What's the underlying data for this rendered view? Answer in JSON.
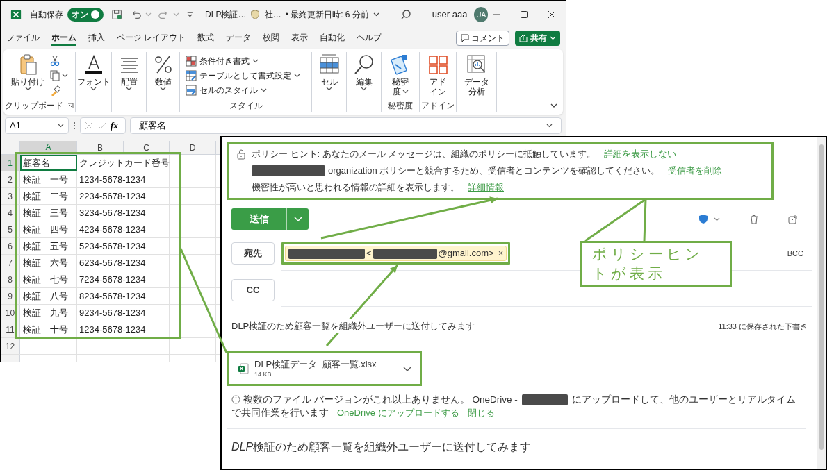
{
  "excel": {
    "autosave": {
      "label": "自動保存",
      "toggle": "オン",
      "on": true
    },
    "title": "DLP検証…",
    "sensitivity": "社…",
    "modified": "• 最終更新日時: 6 分前",
    "user": "user aaa",
    "avatar": "UA",
    "tabs": [
      {
        "label": "ファイル",
        "selected": false
      },
      {
        "label": "ホーム",
        "selected": true
      },
      {
        "label": "挿入",
        "selected": false
      },
      {
        "label": "ページ レイアウト",
        "selected": false
      },
      {
        "label": "数式",
        "selected": false
      },
      {
        "label": "データ",
        "selected": false
      },
      {
        "label": "校閲",
        "selected": false
      },
      {
        "label": "表示",
        "selected": false
      },
      {
        "label": "自動化",
        "selected": false
      },
      {
        "label": "ヘルプ",
        "selected": false
      }
    ],
    "comment_button": "コメント",
    "share_button": "共有",
    "ribbon": [
      {
        "label": "クリップボード",
        "launcher": true,
        "items": [
          {
            "kind": "paste",
            "lines": [
              "貼り付け"
            ],
            "dropdown": true
          },
          {
            "kind": "small_tools"
          }
        ]
      },
      {
        "items": [
          {
            "kind": "font",
            "lines": [
              "フォント"
            ],
            "dropdown": true
          }
        ]
      },
      {
        "items": [
          {
            "kind": "align",
            "lines": [
              "配置"
            ],
            "dropdown": true
          }
        ]
      },
      {
        "items": [
          {
            "kind": "number",
            "lines": [
              "数値"
            ],
            "dropdown": true
          }
        ]
      },
      {
        "label": "スタイル",
        "items": [
          {
            "kind": "style_list",
            "entries": [
              {
                "label": "条件付き書式",
                "dropdown": true
              },
              {
                "label": "テーブルとして書式設定",
                "dropdown": true
              },
              {
                "label": "セルのスタイル",
                "dropdown": true
              }
            ]
          }
        ]
      },
      {
        "items": [
          {
            "kind": "cells",
            "lines": [
              "セル"
            ],
            "dropdown": true
          }
        ]
      },
      {
        "items": [
          {
            "kind": "find",
            "lines": [
              "編集"
            ],
            "dropdown": true
          }
        ]
      },
      {
        "label": "秘密度",
        "items": [
          {
            "kind": "sensitivity",
            "lines": [
              "秘密",
              "度"
            ],
            "dropdown": true
          }
        ]
      },
      {
        "label": "アドイン",
        "items": [
          {
            "kind": "addins",
            "lines": [
              "アド",
              "イン"
            ],
            "dropdown": false
          }
        ]
      },
      {
        "items": [
          {
            "kind": "analyze",
            "lines": [
              "データ",
              "分析"
            ],
            "dropdown": false
          }
        ]
      }
    ],
    "name_box": "A1",
    "fx": "fx",
    "formula": "顧客名",
    "columns": [
      {
        "label": "A",
        "selected": true
      },
      {
        "label": "B",
        "selected": false
      },
      {
        "label": "C",
        "selected": false
      },
      {
        "label": "D",
        "selected": false
      }
    ],
    "rows": [
      {
        "number": "1",
        "cells": [
          {
            "text": "顧客名",
            "selected": true
          },
          {
            "text": "クレジットカード番号",
            "selected": false
          }
        ]
      },
      {
        "number": "2",
        "cells": [
          {
            "text": "検証　一号",
            "selected": false
          },
          {
            "text": "1234-5678-1234",
            "selected": false
          }
        ]
      },
      {
        "number": "3",
        "cells": [
          {
            "text": "検証　二号",
            "selected": false
          },
          {
            "text": "2234-5678-1234",
            "selected": false
          }
        ]
      },
      {
        "number": "4",
        "cells": [
          {
            "text": "検証　三号",
            "selected": false
          },
          {
            "text": "3234-5678-1234",
            "selected": false
          }
        ]
      },
      {
        "number": "5",
        "cells": [
          {
            "text": "検証　四号",
            "selected": false
          },
          {
            "text": "4234-5678-1234",
            "selected": false
          }
        ]
      },
      {
        "number": "6",
        "cells": [
          {
            "text": "検証　五号",
            "selected": false
          },
          {
            "text": "5234-5678-1234",
            "selected": false
          }
        ]
      },
      {
        "number": "7",
        "cells": [
          {
            "text": "検証　六号",
            "selected": false
          },
          {
            "text": "6234-5678-1234",
            "selected": false
          }
        ]
      },
      {
        "number": "8",
        "cells": [
          {
            "text": "検証　七号",
            "selected": false
          },
          {
            "text": "7234-5678-1234",
            "selected": false
          }
        ]
      },
      {
        "number": "9",
        "cells": [
          {
            "text": "検証　八号",
            "selected": false
          },
          {
            "text": "8234-5678-1234",
            "selected": false
          }
        ]
      },
      {
        "number": "10",
        "cells": [
          {
            "text": "検証　九号",
            "selected": false
          },
          {
            "text": "9234-5678-1234",
            "selected": false
          }
        ]
      },
      {
        "number": "11",
        "cells": [
          {
            "text": "検証　十号",
            "selected": false
          },
          {
            "text": "1234-5678-1234",
            "selected": false
          }
        ]
      },
      {
        "number": "12",
        "cells": []
      }
    ]
  },
  "outlook": {
    "policy_hint": {
      "lines": [
        {
          "text": "ポリシー ヒント: あなたのメール メッセージは、組織のポリシーに抵触しています。",
          "link": "詳細を表示しない",
          "underline": false
        },
        {
          "text": "organization ポリシーと競合するため、受信者とコンテンツを確認してください。",
          "link": "受信者を削除",
          "underline": false
        },
        {
          "text": "機密性が高いと思われる情報の詳細を表示します。",
          "link": "詳細情報",
          "underline": true
        }
      ]
    },
    "send_button": "送信",
    "to_button": "宛先",
    "recipient": {
      "prefix": "<",
      "suffix": "@gmail.com>",
      "remove": "×"
    },
    "bcc": "BCC",
    "cc_button": "CC",
    "subject": "DLP検証のため顧客一覧を組織外ユーザーに送付してみます",
    "saved": "11:33 に保存された下書き",
    "attachment": {
      "name": "DLP検証データ_顧客一覧.xlsx",
      "size": "14 KB"
    },
    "notice": {
      "before": "複数のファイル バージョンがこれ以上ありません。 OneDrive -",
      "after": "にアップロードして、他のユーザーとリアルタイム",
      "continued": "で共同作業を行います",
      "links": [
        "OneDrive にアップロードする",
        "閉じる"
      ]
    },
    "body": [
      {
        "text": "DLP",
        "italic": true
      },
      {
        "text": "検証のため顧客一覧を組織外ユーザーに送付してみます",
        "italic": false
      }
    ]
  },
  "annotation": {
    "callout": "ポリシーヒントが表示"
  }
}
